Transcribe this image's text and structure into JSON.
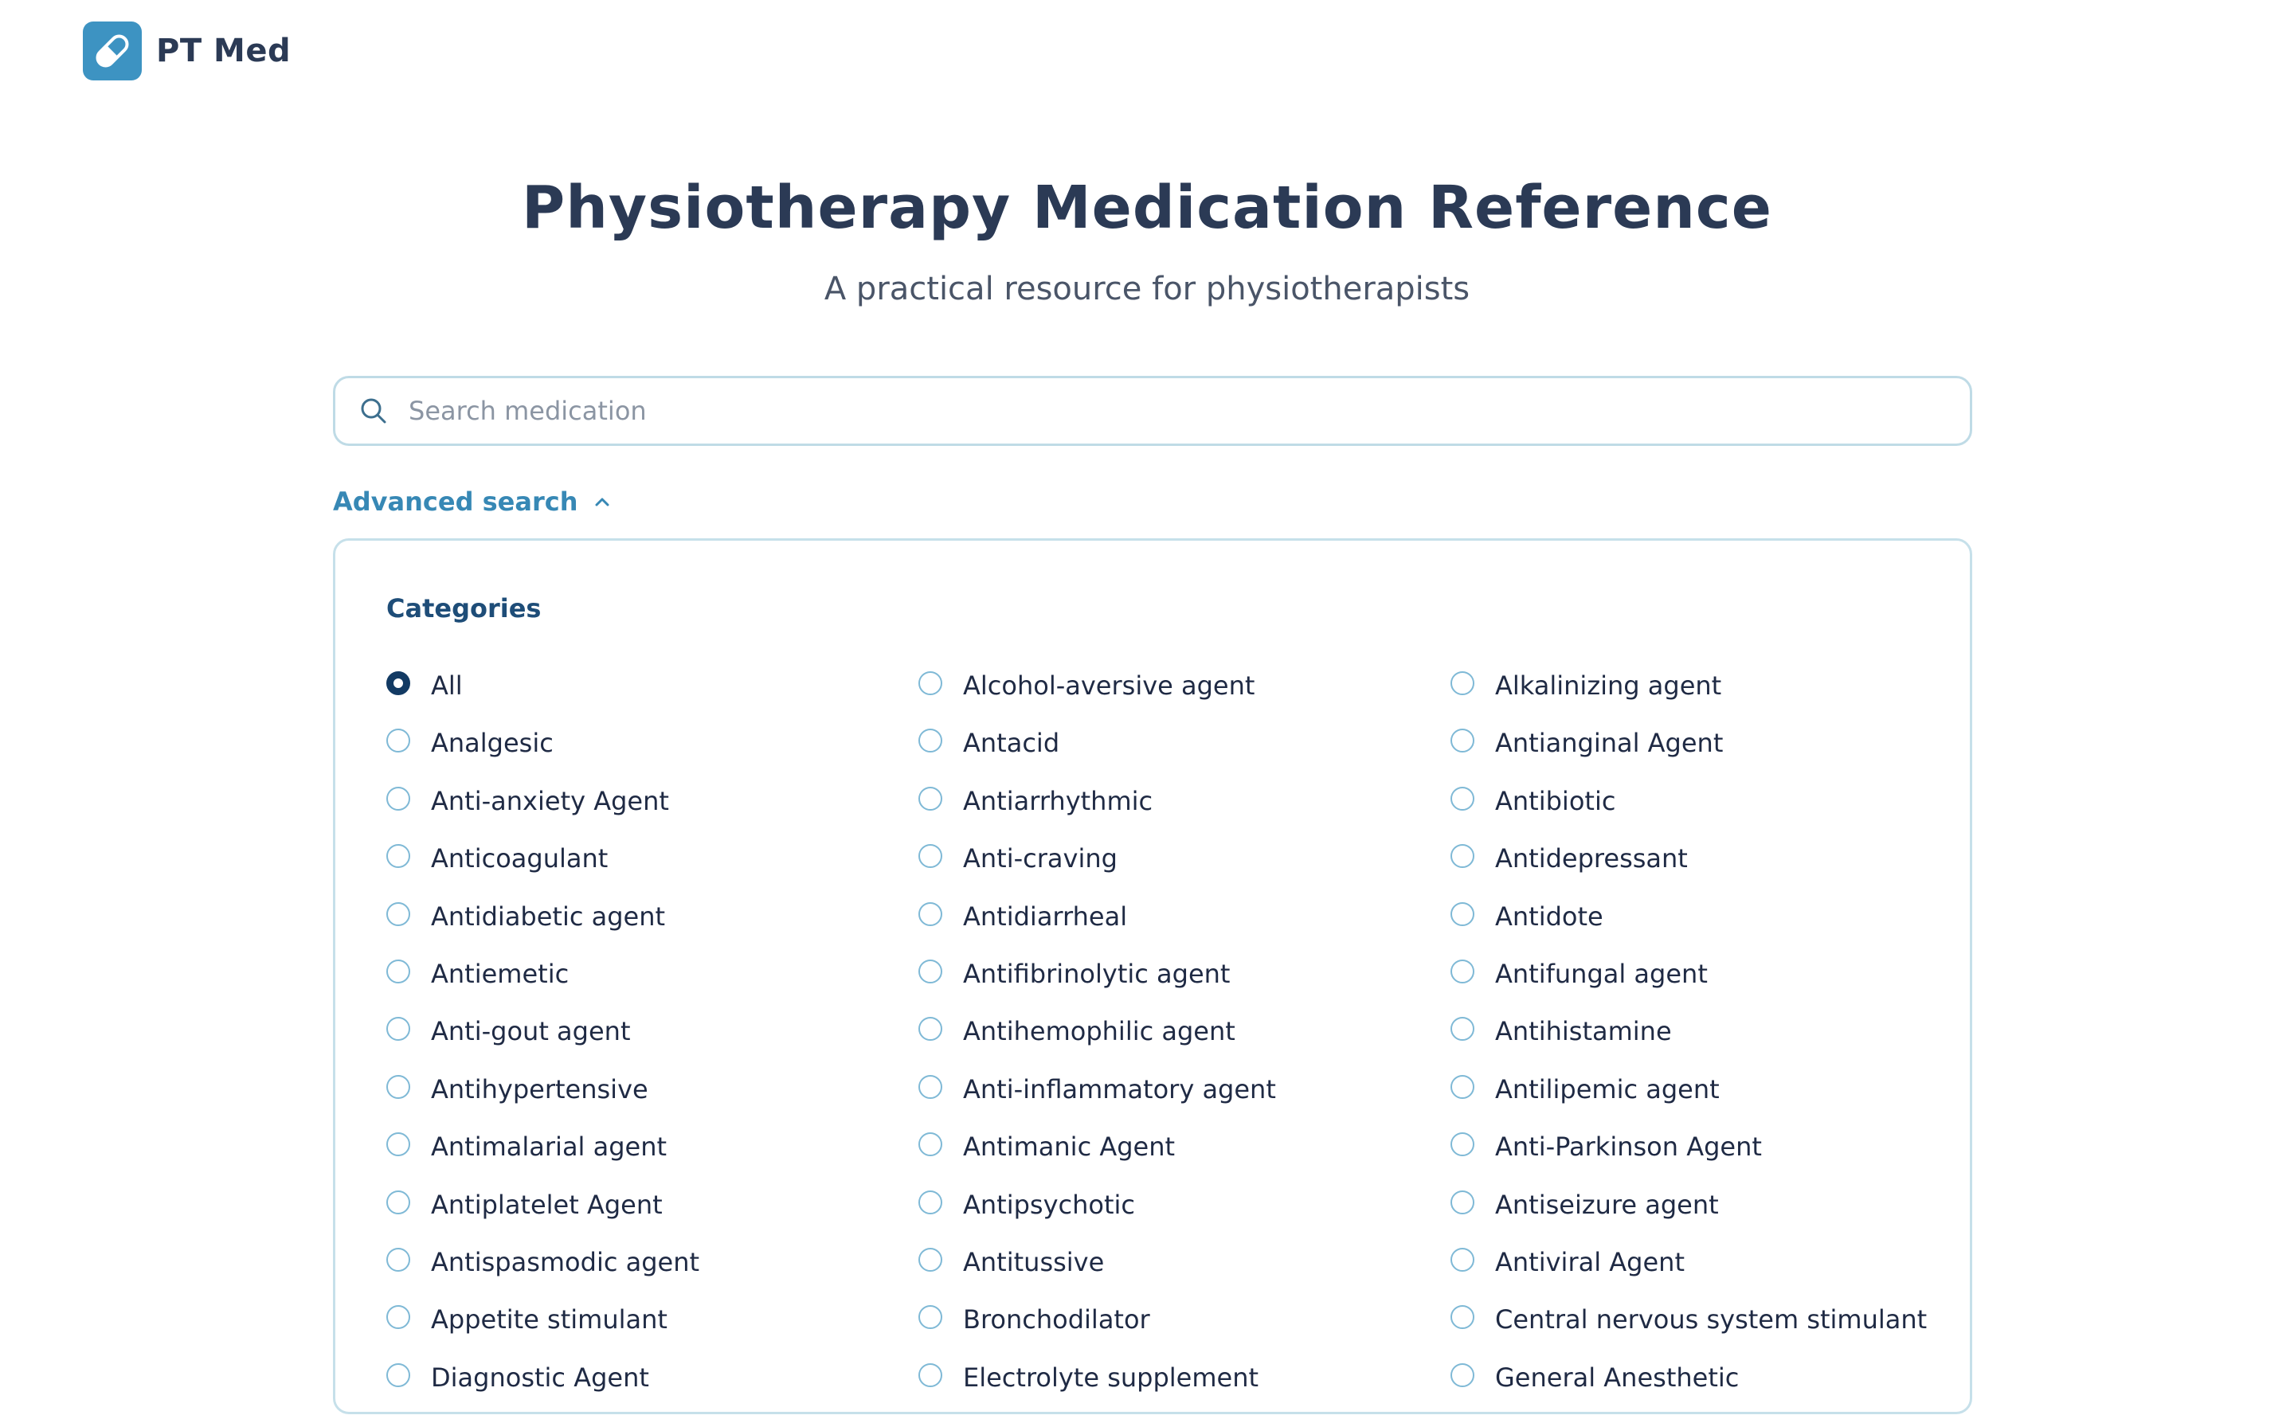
{
  "brand": {
    "name": "PT Med",
    "logo_icon": "pill-icon",
    "logo_color": "#3d93c2"
  },
  "hero": {
    "title": "Physiotherapy Medication Reference",
    "subtitle": "A practical resource for physiotherapists"
  },
  "search": {
    "placeholder": "Search medication",
    "value": ""
  },
  "advanced": {
    "toggle_label": "Advanced search",
    "expanded": true,
    "categories_heading": "Categories",
    "selected": "All",
    "categories": [
      "All",
      "Alcohol-aversive agent",
      "Alkalinizing agent",
      "Analgesic",
      "Antacid",
      "Antianginal Agent",
      "Anti-anxiety Agent",
      "Antiarrhythmic",
      "Antibiotic",
      "Anticoagulant",
      "Anti-craving",
      "Antidepressant",
      "Antidiabetic agent",
      "Antidiarrheal",
      "Antidote",
      "Antiemetic",
      "Antifibrinolytic agent",
      "Antifungal agent",
      "Anti-gout agent",
      "Antihemophilic agent",
      "Antihistamine",
      "Antihypertensive",
      "Anti-inflammatory agent",
      "Antilipemic agent",
      "Antimalarial agent",
      "Antimanic Agent",
      "Anti-Parkinson Agent",
      "Antiplatelet Agent",
      "Antipsychotic",
      "Antiseizure agent",
      "Antispasmodic agent",
      "Antitussive",
      "Antiviral Agent",
      "Appetite stimulant",
      "Bronchodilator",
      "Central nervous system stimulant",
      "Diagnostic Agent",
      "Electrolyte supplement",
      "General Anesthetic"
    ]
  },
  "colors": {
    "accent": "#3788b5",
    "heading_dark": "#2b3a55",
    "radio_selected": "#123a63",
    "radio_border": "#7fb9d6",
    "panel_border": "#c6e0ea"
  }
}
